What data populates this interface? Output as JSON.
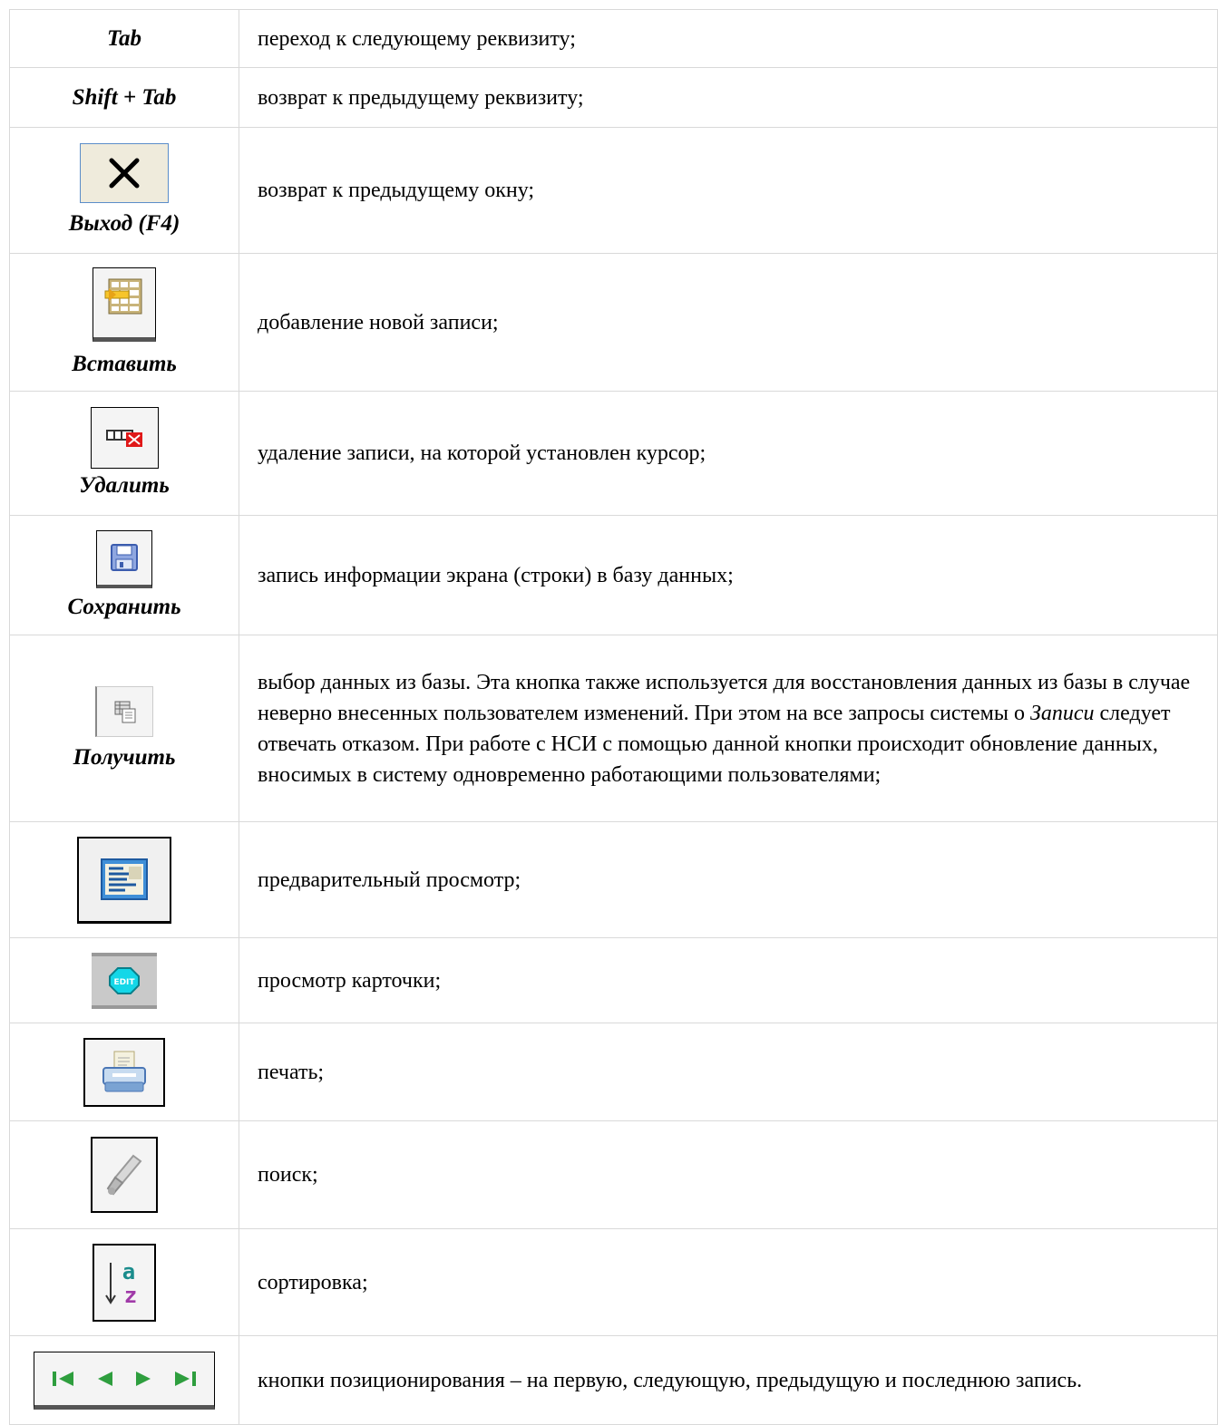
{
  "rows": [
    {
      "key": "Tab",
      "desc": "переход к следующему реквизиту;"
    },
    {
      "key": "Shift + Tab",
      "desc": "возврат к предыдущему реквизиту;"
    },
    {
      "key": "Выход (F4)",
      "icon": "close-icon",
      "desc": "возврат к предыдущему окну;"
    },
    {
      "key": "Вставить",
      "icon": "insert-record-icon",
      "desc": "добавление новой записи;"
    },
    {
      "key": "Удалить",
      "icon": "delete-record-icon",
      "desc": "удаление записи, на которой установлен курсор;"
    },
    {
      "key": "Сохранить",
      "icon": "floppy-disk-icon",
      "desc": "запись информации экрана (строки) в базу данных;"
    },
    {
      "key": "Получить",
      "icon": "retrieve-icon",
      "desc_parts": [
        "выбор данных из базы. Эта кнопка также используется для восстановления данных из базы в случае неверно внесенных пользователем изменений. При этом на все запросы системы о ",
        "Записи",
        " следует отвечать отказом. При работе с НСИ с помощью данной кнопки происходит обновление данных, вносимых в систему одновременно работающими пользователями;"
      ]
    },
    {
      "icon": "preview-icon",
      "desc": "предварительный просмотр;"
    },
    {
      "icon": "edit-card-icon",
      "icon_text": "EDIT",
      "desc": "просмотр карточки;"
    },
    {
      "icon": "printer-icon",
      "desc": "печать;"
    },
    {
      "icon": "search-icon",
      "desc": "поиск;"
    },
    {
      "icon": "sort-az-icon",
      "icon_text_a": "a",
      "icon_text_z": "z",
      "desc": "сортировка;"
    },
    {
      "icon": "navigation-icons",
      "desc": "кнопки позиционирования – на первую, следующую,  предыдущую и последнюю запись."
    }
  ],
  "colors": {
    "border": "#d9d9d9",
    "nav_green": "#2e9e3e",
    "edit_cyan": "#14d7e8",
    "sort_teal": "#1a8c8c",
    "sort_purple": "#a03aa8"
  }
}
